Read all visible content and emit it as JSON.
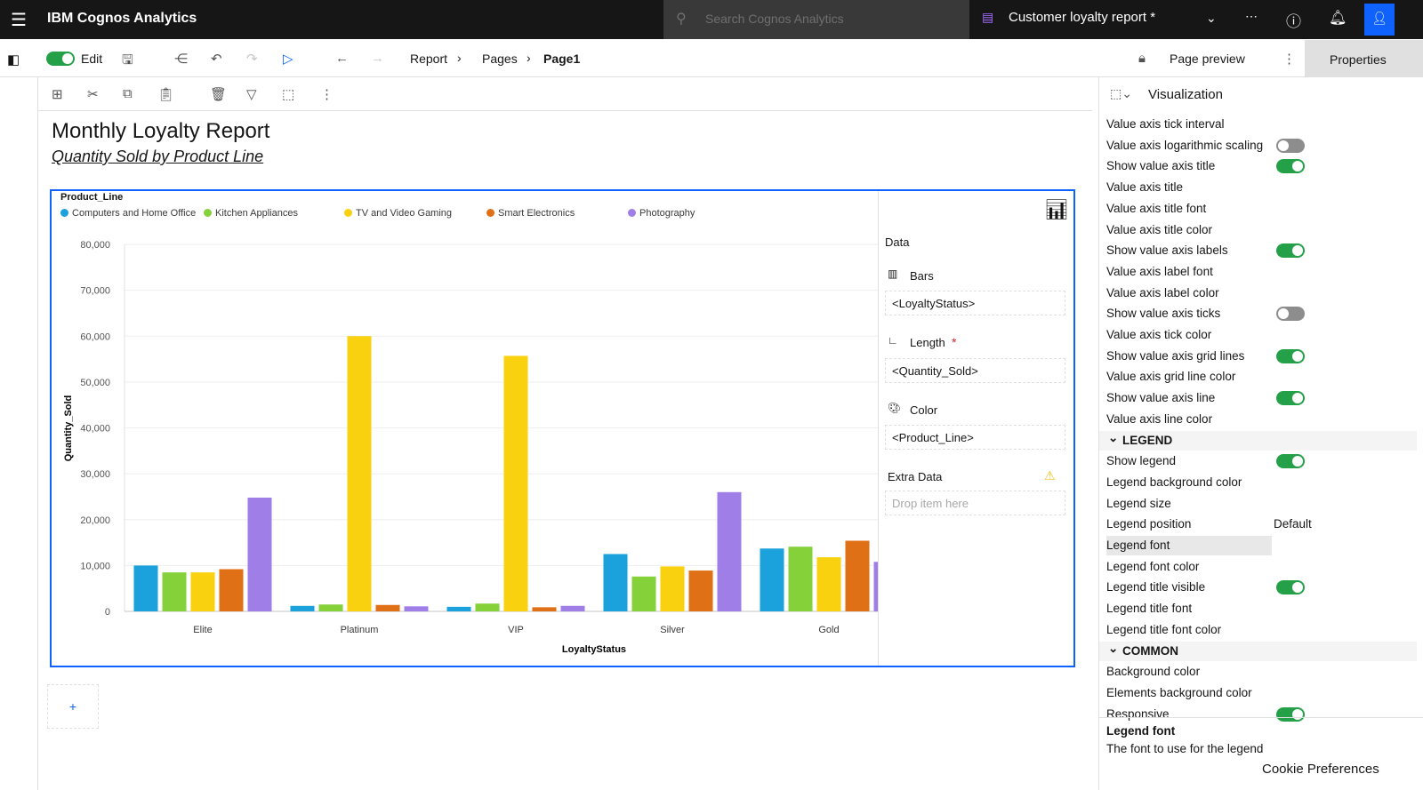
{
  "app": {
    "title": "IBM Cognos Analytics",
    "search_placeholder": "Search Cognos Analytics",
    "report_name": "Customer loyalty report *"
  },
  "toolbar": {
    "edit_label": "Edit",
    "breadcrumb": [
      "Report",
      "Pages",
      "Page1"
    ],
    "page_preview": "Page preview",
    "properties": "Properties"
  },
  "report": {
    "title": "Monthly Loyalty Report",
    "subtitle": "Quantity Sold by Product Line"
  },
  "data_panel": {
    "heading": "Data",
    "bars_label": "Bars",
    "bars_value": "<LoyaltyStatus>",
    "length_label": "Length",
    "required": "*",
    "length_value": "<Quantity_Sold>",
    "color_label": "Color",
    "color_value": "<Product_Line>",
    "extra_label": "Extra Data",
    "extra_placeholder": "Drop item here"
  },
  "chart_data": {
    "type": "bar",
    "legend_title": "Product_Line",
    "legend_position": "top-left",
    "xlabel": "LoyaltyStatus",
    "ylabel": "Quantity_Sold",
    "ylim": [
      0,
      80000
    ],
    "yticks": [
      "80,000",
      "70,000",
      "60,000",
      "50,000",
      "40,000",
      "30,000",
      "20,000",
      "10,000",
      "0"
    ],
    "grid": true,
    "categories": [
      "Elite",
      "Platinum",
      "VIP",
      "Silver",
      "Gold"
    ],
    "series": [
      {
        "name": "Computers and Home Office",
        "color": "#1ba1dc",
        "values": [
          10000,
          1200,
          1000,
          12500,
          13700
        ]
      },
      {
        "name": "Kitchen Appliances",
        "color": "#84d13a",
        "values": [
          8500,
          1500,
          1700,
          7600,
          14100
        ]
      },
      {
        "name": "TV and Video Gaming",
        "color": "#f9d10f",
        "values": [
          8500,
          60000,
          55700,
          9800,
          11800
        ]
      },
      {
        "name": "Smart Electronics",
        "color": "#e07016",
        "values": [
          9200,
          1400,
          900,
          8900,
          15400
        ]
      },
      {
        "name": "Photography",
        "color": "#a07ee8",
        "values": [
          24800,
          1100,
          1200,
          26000,
          10800
        ]
      }
    ]
  },
  "properties": {
    "header": "Visualization",
    "rows": [
      {
        "label": "Value axis tick interval"
      },
      {
        "label": "Value axis logarithmic scaling",
        "toggle": false
      },
      {
        "label": "Show value axis title",
        "toggle": true
      },
      {
        "label": "Value axis title"
      },
      {
        "label": "Value axis title font"
      },
      {
        "label": "Value axis title color"
      },
      {
        "label": "Show value axis labels",
        "toggle": true
      },
      {
        "label": "Value axis label font"
      },
      {
        "label": "Value axis label color"
      },
      {
        "label": "Show value axis ticks",
        "toggle": false
      },
      {
        "label": "Value axis tick color"
      },
      {
        "label": "Show value axis grid lines",
        "toggle": true
      },
      {
        "label": "Value axis grid line color"
      },
      {
        "label": "Show value axis line",
        "toggle": true
      },
      {
        "label": "Value axis line color"
      },
      {
        "label": "LEGEND",
        "section": true
      },
      {
        "label": "Show legend",
        "toggle": true
      },
      {
        "label": "Legend background color"
      },
      {
        "label": "Legend size"
      },
      {
        "label": "Legend position",
        "value": "Default"
      },
      {
        "label": "Legend font",
        "selected": true
      },
      {
        "label": "Legend font color"
      },
      {
        "label": "Legend title visible",
        "toggle": true
      },
      {
        "label": "Legend title font"
      },
      {
        "label": "Legend title font color"
      },
      {
        "label": "COMMON",
        "section": true
      },
      {
        "label": "Background color"
      },
      {
        "label": "Elements background color"
      },
      {
        "label": "Responsive",
        "toggle": true
      }
    ],
    "help_title": "Legend font",
    "help_text": "The font to use for the legend",
    "cookie": "Cookie Preferences"
  }
}
